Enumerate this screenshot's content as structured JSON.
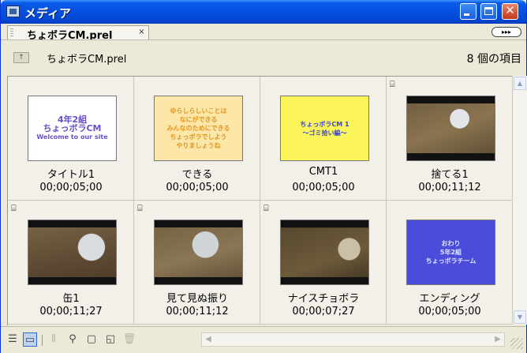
{
  "window": {
    "title": "メディア"
  },
  "tab": {
    "label": "ちょボラCM.prel",
    "close_glyph": "×",
    "menu_glyph": "▸▸▸"
  },
  "path": {
    "up_glyph": "↑",
    "name": "ちょボラCM.prel",
    "item_count": "8 個の項目"
  },
  "items": [
    {
      "name": "タイトル1",
      "duration": "00;00;05;00",
      "kind": "title",
      "has_film_icon": false,
      "thumb_lines": [
        "4年2組",
        "ちょっボラCM",
        "Welcome to our site"
      ],
      "thumb_bg": "#ffffff",
      "thumb_fg": "#6a4fc8"
    },
    {
      "name": "できる",
      "duration": "00;00;05;00",
      "kind": "title",
      "has_film_icon": false,
      "thumb_lines": [
        "ゆらしらしいことは",
        "なにができる",
        "みんなのためにできる",
        "ちょっボラでしよう",
        "やりましょうね"
      ],
      "thumb_bg": "#fde7a8",
      "thumb_fg": "#e3941e"
    },
    {
      "name": "CMT1",
      "duration": "00;00;05;00",
      "kind": "title",
      "has_film_icon": false,
      "thumb_lines": [
        "ちょっボラCM 1",
        "〜ゴミ拾い編〜"
      ],
      "thumb_bg": "#fbf55a",
      "thumb_fg": "#3c46c8"
    },
    {
      "name": "捨てる1",
      "duration": "00;00;11;12",
      "kind": "video",
      "has_film_icon": true
    },
    {
      "name": "缶1",
      "duration": "00;00;11;27",
      "kind": "video",
      "has_film_icon": true
    },
    {
      "name": "見て見ぬ振り",
      "duration": "00;00;11;12",
      "kind": "video",
      "has_film_icon": true
    },
    {
      "name": "ナイスチョボラ",
      "duration": "00;00;07;27",
      "kind": "video",
      "has_film_icon": true
    },
    {
      "name": "エンディング",
      "duration": "00;00;05;00",
      "kind": "title",
      "has_film_icon": false,
      "thumb_lines": [
        "おわり",
        "5年2組",
        "ちょっボラチーム"
      ],
      "thumb_bg": "#4b4cd9",
      "thumb_fg": "#e0e4ff"
    }
  ],
  "colors": {
    "titlebar": "#0650e0",
    "panel": "#ece9d8",
    "selection": "#c1d2ee"
  }
}
